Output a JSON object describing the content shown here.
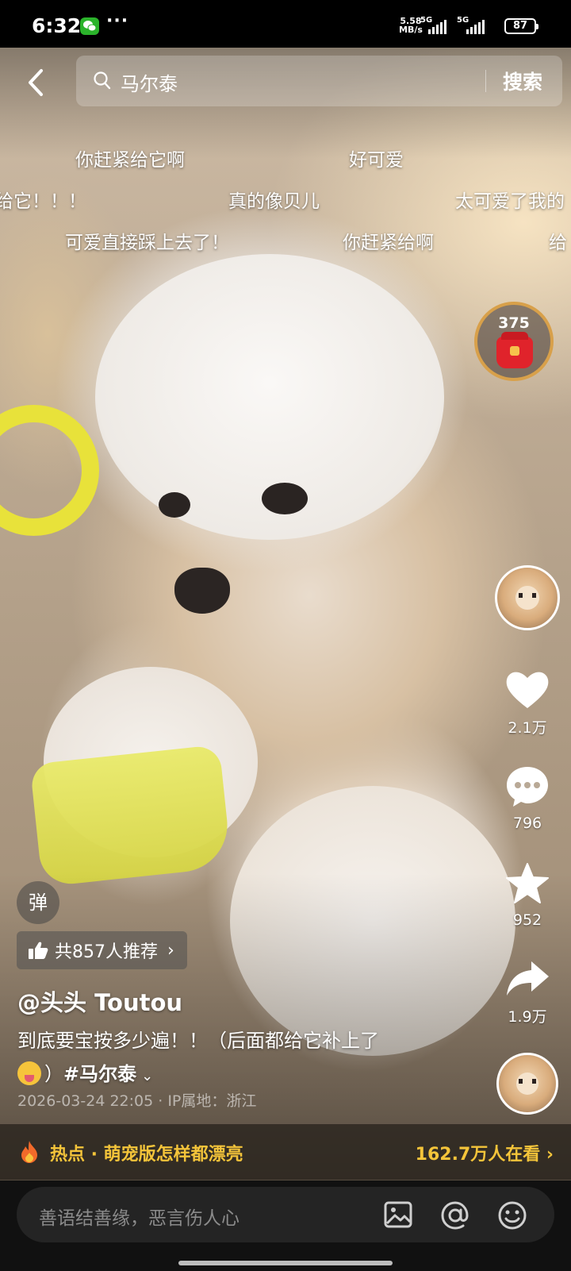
{
  "status_bar": {
    "time": "6:32",
    "more": "···",
    "speed_value": "5.58",
    "speed_unit": "MB/s",
    "net1": "5G",
    "net2": "5G",
    "battery": "87"
  },
  "search": {
    "query": "马尔泰",
    "button": "搜索"
  },
  "danmaku": [
    "你赶紧给它啊",
    "好可爱",
    "给它！！！",
    "真的像贝儿",
    "太可爱了我的",
    "可爱直接踩上去了！",
    "你赶紧给啊",
    "给"
  ],
  "red_packet": {
    "count": "375"
  },
  "rail": {
    "likes": "2.1万",
    "comments": "796",
    "favorites": "952",
    "shares": "1.9万"
  },
  "danmu_toggle": "弹",
  "recommend": "共857人推荐",
  "author": "@头头 Toutou",
  "caption": {
    "line1": "到底要宝按多少遍！！（后面都给它补上了",
    "line2_text": "）",
    "hashtag": "#马尔泰"
  },
  "meta": "2026-03-24 22:05 · IP属地：浙江",
  "hot": {
    "left": "热点 · 萌宠版怎样都漂亮",
    "right": "162.7万人在看 ›"
  },
  "comment": {
    "placeholder": "善语结善缘，恶言伤人心"
  },
  "colors": {
    "accent_yellow": "#f4c43a",
    "red_packet": "#e0232b",
    "wechat_green": "#2bb32b"
  }
}
